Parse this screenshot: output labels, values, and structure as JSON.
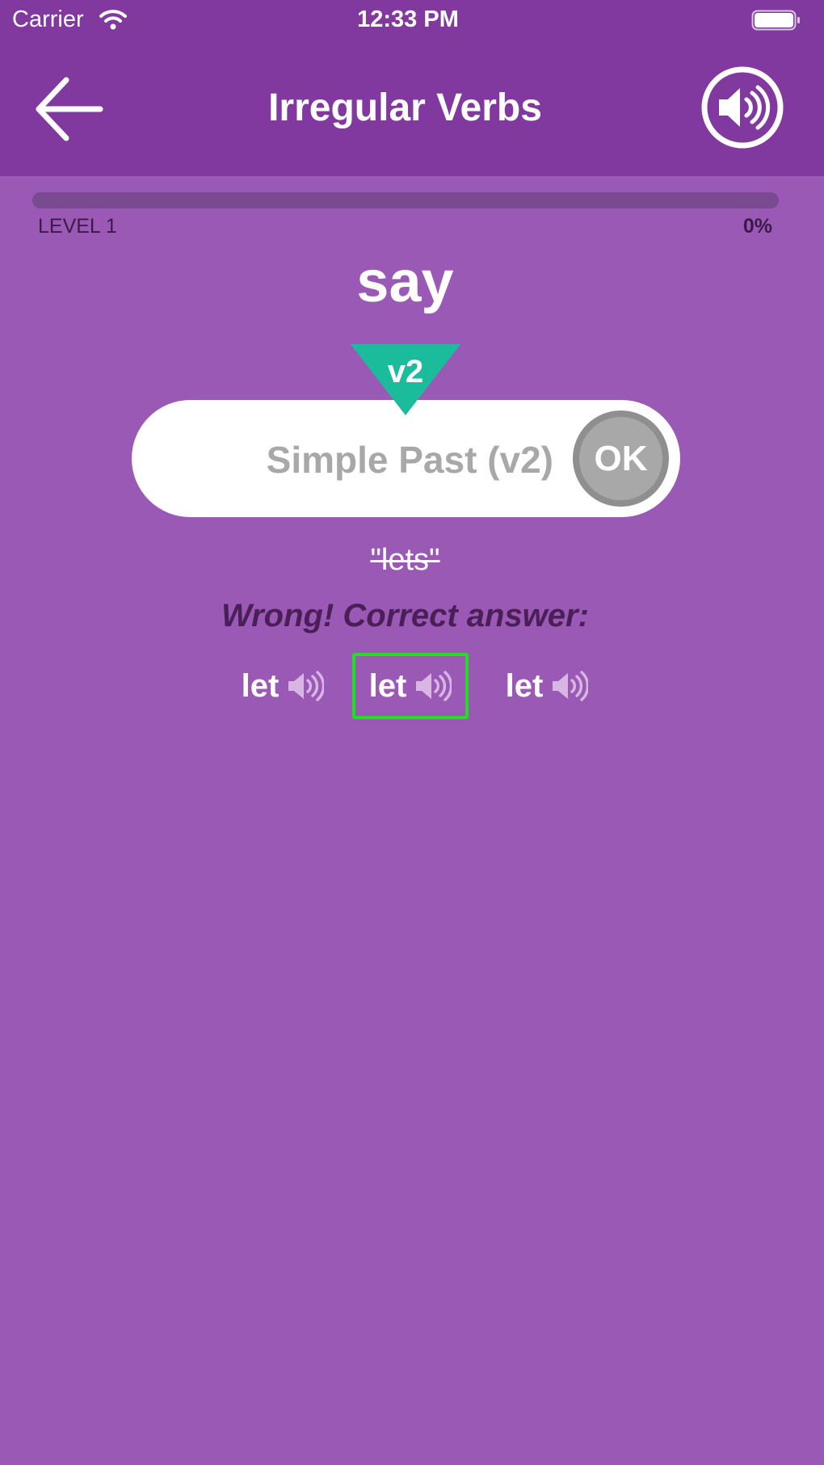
{
  "status_bar": {
    "carrier": "Carrier",
    "time": "12:33 PM"
  },
  "header": {
    "title": "Irregular Verbs",
    "back_icon": "arrow-left-icon",
    "sound_icon": "speaker-icon"
  },
  "progress": {
    "level_label": "LEVEL 1",
    "percent_label": "0%",
    "fraction": 0
  },
  "question": {
    "verb": "say",
    "form_marker": "v2",
    "input_placeholder": "Simple Past (v2)",
    "ok_label": "OK"
  },
  "feedback": {
    "user_answer": "\"lets\"",
    "message": "Wrong! Correct answer:",
    "correct_forms": [
      {
        "text": "let",
        "highlighted": false
      },
      {
        "text": "let",
        "highlighted": true
      },
      {
        "text": "let",
        "highlighted": false
      }
    ]
  },
  "colors": {
    "header_bg": "#8139a0",
    "page_bg": "#9a59b5",
    "marker": "#1abc9c",
    "ok_button": "#a8a8a8",
    "highlight_border": "#22dd22"
  }
}
